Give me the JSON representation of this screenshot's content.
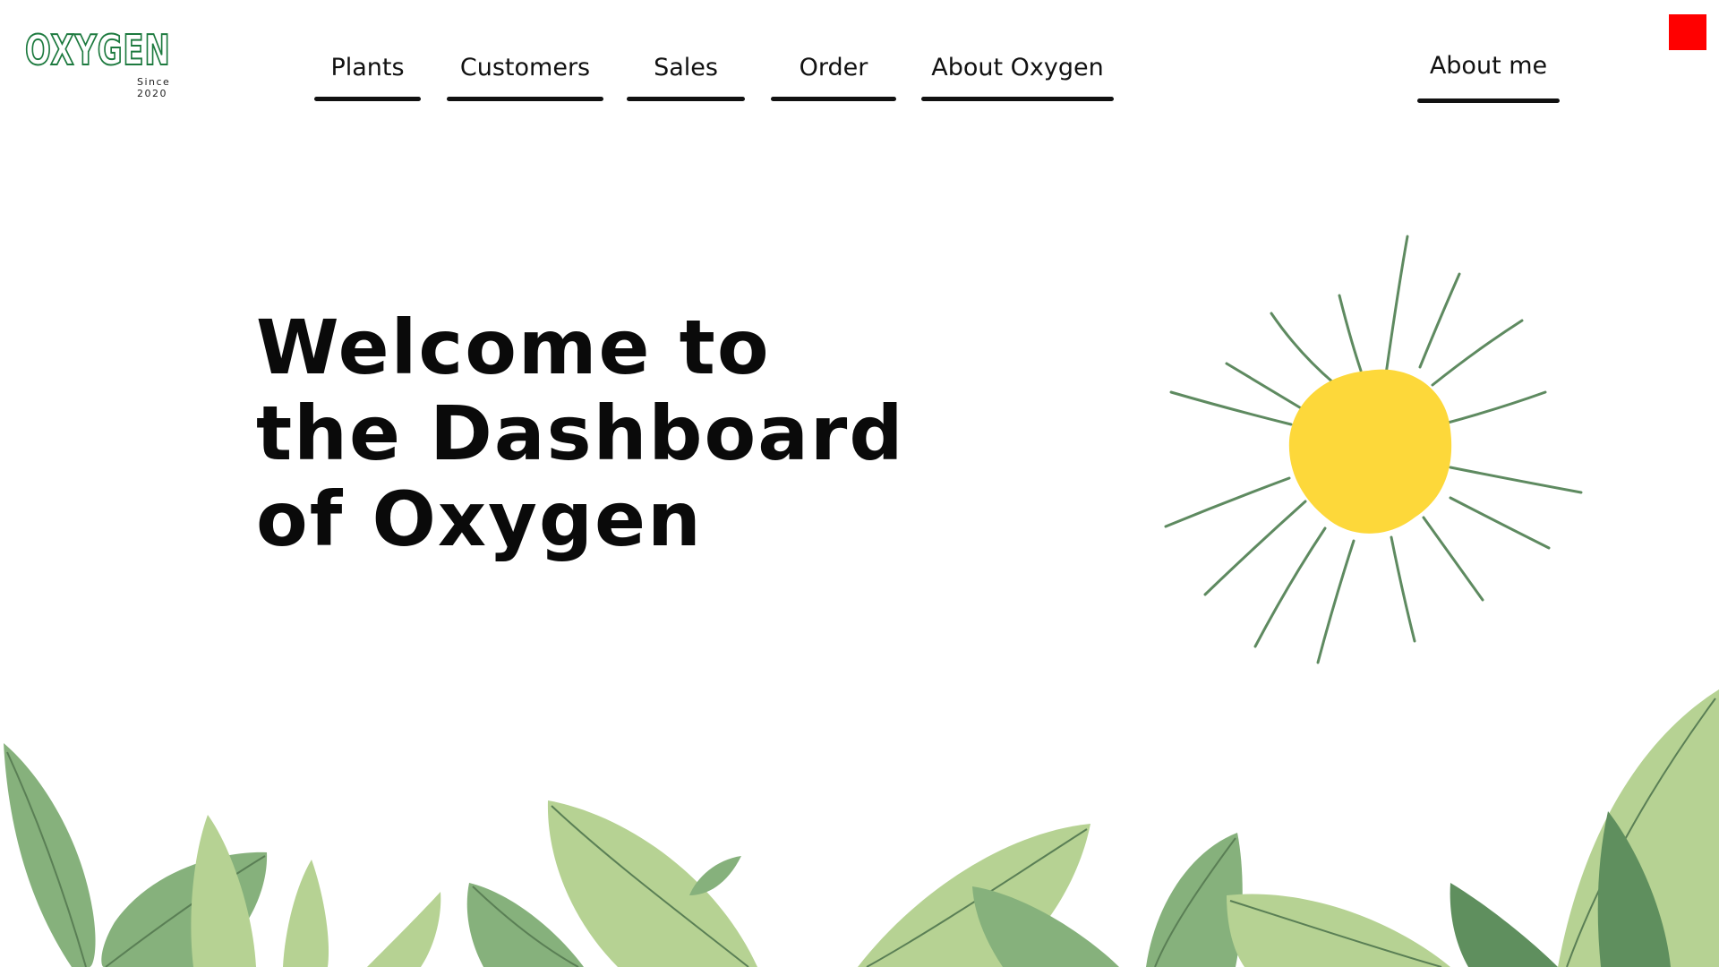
{
  "logo": {
    "word": "OXYGEN",
    "since": "Since 2020",
    "color": "#1d7a3f"
  },
  "nav": {
    "plants": "Plants",
    "customers": "Customers",
    "sales": "Sales",
    "order": "Order",
    "about_oxygen": "About Oxygen",
    "about_me": "About me"
  },
  "close_button": {
    "color": "#ff0000",
    "icon": "close-square-icon"
  },
  "hero": {
    "line1": "Welcome to",
    "line2": "the Dashboard",
    "line3": "of Oxygen"
  },
  "illustration": {
    "sun_color": "#fdd83a",
    "ray_color": "#5e8a60",
    "leaf_colors": [
      "#86b17c",
      "#b6d293",
      "#5f8f5e",
      "#a9c98b"
    ]
  }
}
